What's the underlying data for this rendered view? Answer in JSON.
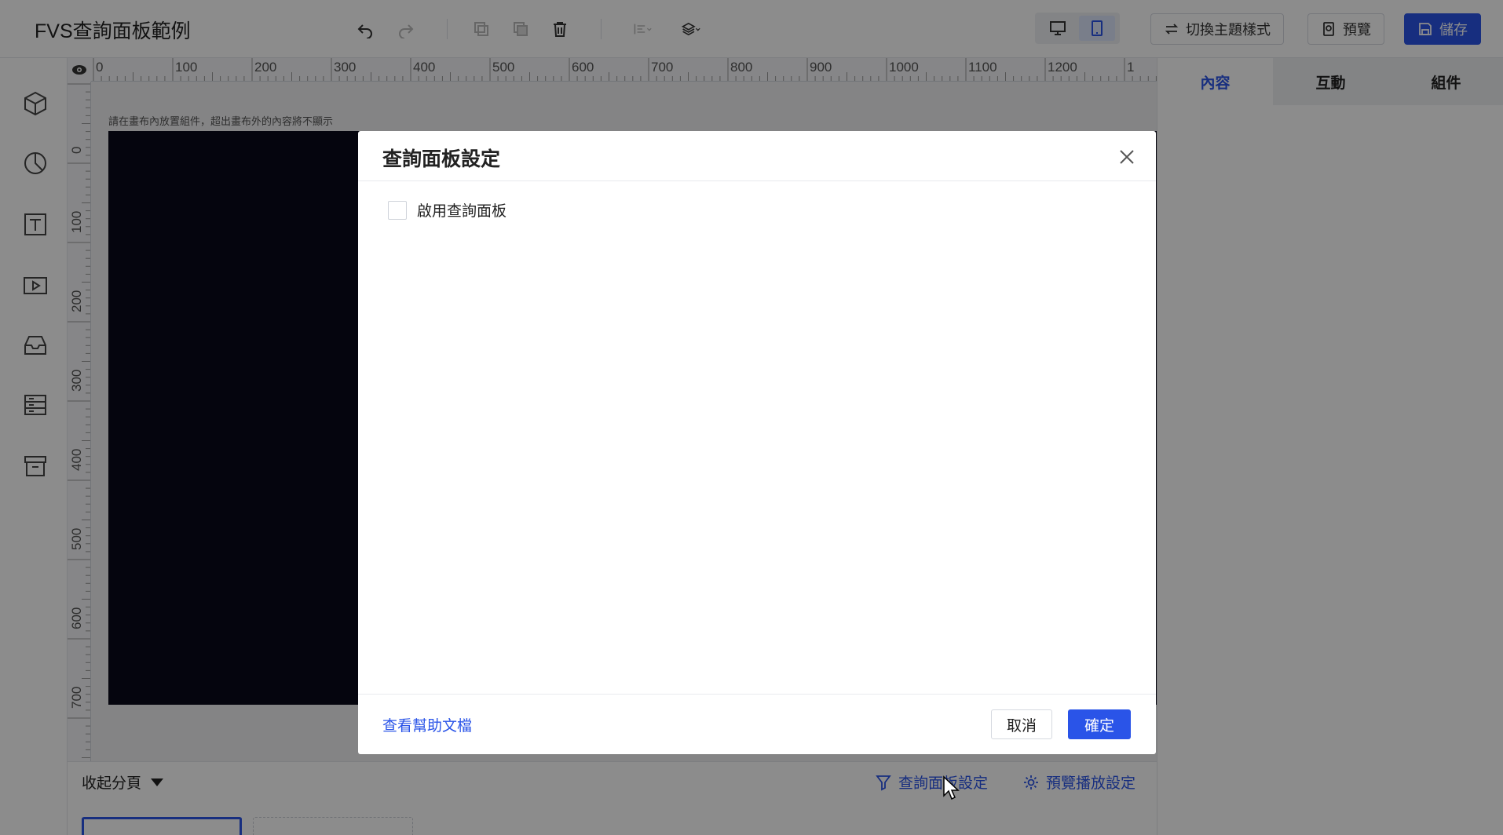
{
  "app": {
    "title": "FVS查詢面板範例"
  },
  "toolbar": {
    "icons": [
      "undo-icon",
      "redo-icon",
      "copy-icon",
      "paste-icon",
      "trash-icon",
      "align-icon",
      "layers-icon"
    ],
    "view_modes": [
      "desktop",
      "tablet"
    ],
    "active_view": "tablet",
    "switch_theme_label": "切換主題樣式",
    "preview_label": "預覽",
    "save_label": "儲存"
  },
  "sidebar": {
    "icons": [
      "component-cube-icon",
      "chart-pie-icon",
      "text-icon",
      "media-icon",
      "inbox-icon",
      "table-list-icon",
      "archive-icon"
    ]
  },
  "canvas": {
    "hint": "請在畫布內放置組件，超出畫布外的內容將不顯示",
    "ruler_h": [
      "0",
      "100",
      "200",
      "300",
      "400",
      "500",
      "600",
      "700",
      "800",
      "900",
      "1000",
      "1100",
      "1200",
      "1"
    ],
    "ruler_v": [
      "0",
      "100",
      "200",
      "300",
      "400",
      "500",
      "600",
      "700"
    ]
  },
  "pagebar": {
    "collapse_label": "收起分頁",
    "query_panel_label": "查詢面板設定",
    "playback_label": "預覽播放設定"
  },
  "right_panel": {
    "tabs": [
      "內容",
      "互動",
      "組件"
    ],
    "active_tab": "內容"
  },
  "modal": {
    "title": "查詢面板設定",
    "checkbox_label": "啟用查詢面板",
    "checkbox_checked": false,
    "help_link": "查看幫助文檔",
    "cancel_label": "取消",
    "ok_label": "確定"
  },
  "colors": {
    "accent": "#2a54e8",
    "overlay": "rgba(0,0,0,0.45)"
  }
}
